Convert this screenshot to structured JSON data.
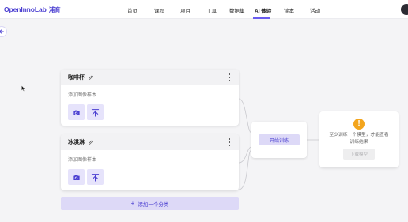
{
  "header": {
    "logo_text": "OpenInnoLab",
    "logo_cn": "浦育",
    "nav": [
      {
        "label": "首页",
        "active": false
      },
      {
        "label": "课程",
        "active": false
      },
      {
        "label": "项目",
        "active": false
      },
      {
        "label": "工具",
        "active": false
      },
      {
        "label": "数据集",
        "active": false
      },
      {
        "label": "AI 体验",
        "active": true
      },
      {
        "label": "读本",
        "active": false
      },
      {
        "label": "活动",
        "active": false
      }
    ]
  },
  "classes": [
    {
      "name": "咖啡杯",
      "add_sample_label": "添加图像样本",
      "tools": [
        "camera-icon",
        "upload-icon"
      ]
    },
    {
      "name": "冰淇淋",
      "add_sample_label": "添加图像样本",
      "tools": [
        "camera-icon",
        "upload-icon"
      ]
    }
  ],
  "add_class_label": "添加一个分类",
  "training": {
    "button_label": "开始训练"
  },
  "result": {
    "message": "至少训练一个模型，才能查看训练结果",
    "export_label": "下载模型"
  },
  "colors": {
    "accent": "#4b3fd1",
    "accent_light": "#ddd9f7",
    "warning": "#f3a51d"
  }
}
